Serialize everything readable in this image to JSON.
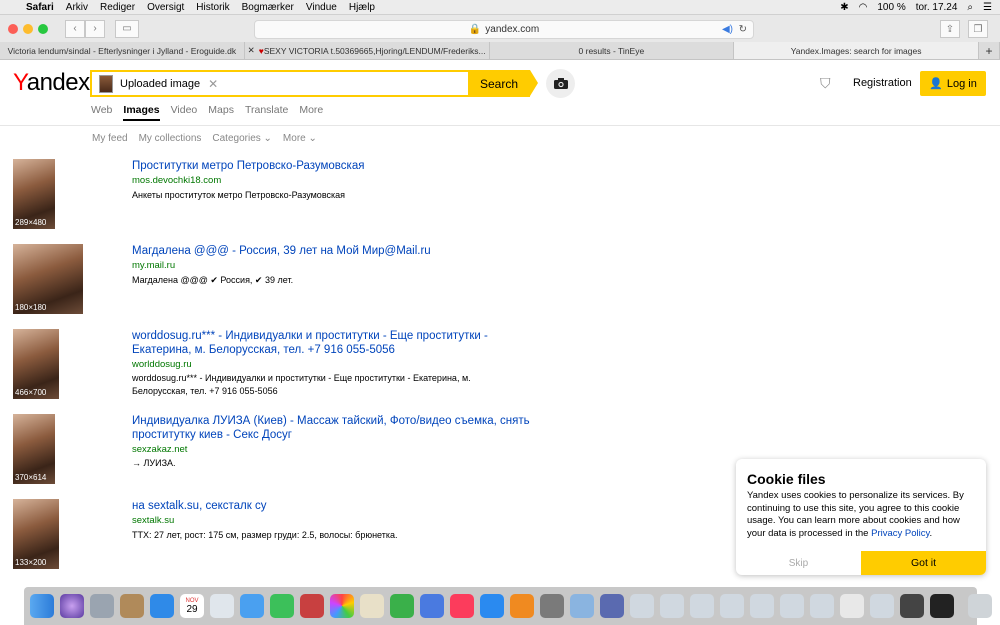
{
  "menubar": {
    "app": "Safari",
    "items": [
      "Arkiv",
      "Rediger",
      "Oversigt",
      "Historik",
      "Bogmærker",
      "Vindue",
      "Hjælp"
    ],
    "battery": "100 %",
    "clock": "tor. 17.24"
  },
  "browser": {
    "url": "yandex.com",
    "tabs": [
      "Victoria lendum/sindal - Efterlysninger i Jylland - Eroguide.dk",
      "SEXY VICTORIA t.50369665,Hjoring/LENDUM/Frederiks...",
      "0 results - TinEye",
      "Yandex.Images: search for images"
    ],
    "new_tab": "+"
  },
  "header": {
    "logo_y": "Y",
    "logo_rest": "andex",
    "search_value": "Uploaded image",
    "clear": "✕",
    "search_button": "Search",
    "registration": "Registration",
    "login": "Log in"
  },
  "services": [
    "Web",
    "Images",
    "Video",
    "Maps",
    "Translate",
    "More"
  ],
  "subnav": [
    "My feed",
    "My collections",
    "Categories ⌄",
    "More ⌄"
  ],
  "results": [
    {
      "dims": "289×480",
      "title": "Проститутки метро Петровско-Разумовская",
      "url": "mos.devochki18.com",
      "desc": "Анкеты проституток метро Петровско-Разумовская"
    },
    {
      "dims": "180×180",
      "title": "Магдалена @@@ - Россия, 39 лет на Мой Мир@Mail.ru",
      "url": "my.mail.ru",
      "desc": "Магдалена @@@ ✔ Россия, ✔ 39 лет."
    },
    {
      "dims": "466×700",
      "title": "worddosug.ru*** - Индивидуалки и проститутки - Еще проститутки - Екатерина, м. Белорусская, тел. +7 916 055-5056",
      "url": "worlddosug.ru",
      "desc": "worddosug.ru*** - Индивидуалки и проститутки - Еще проститутки - Екатерина, м. Белорусская, тел. +7 916 055-5056"
    },
    {
      "dims": "370×614",
      "title": "Индивидуалка ЛУИЗА (Киев) - Массаж тайский, Фото/видео съемка, снять проститутку киев - Секс Досуг",
      "url": "sexzakaz.net",
      "desc": "→ ЛУИЗА."
    },
    {
      "dims": "133×200",
      "title": "на sextalk.su, сексталк су",
      "url": "sextalk.su",
      "desc": "ТТХ: 27 лет, рост: 175 см, размер груди: 2.5, волосы: брюнетка."
    }
  ],
  "cookie": {
    "title": "Cookie files",
    "text": "Yandex uses cookies to personalize its services. By continuing to use this site, you agree to this cookie usage. You can learn more about cookies and how your data is processed in the",
    "link": "Privacy Policy",
    "skip": "Skip",
    "got_it": "Got it"
  },
  "dock": {
    "calendar_month": "NOV",
    "calendar_day": "29"
  }
}
